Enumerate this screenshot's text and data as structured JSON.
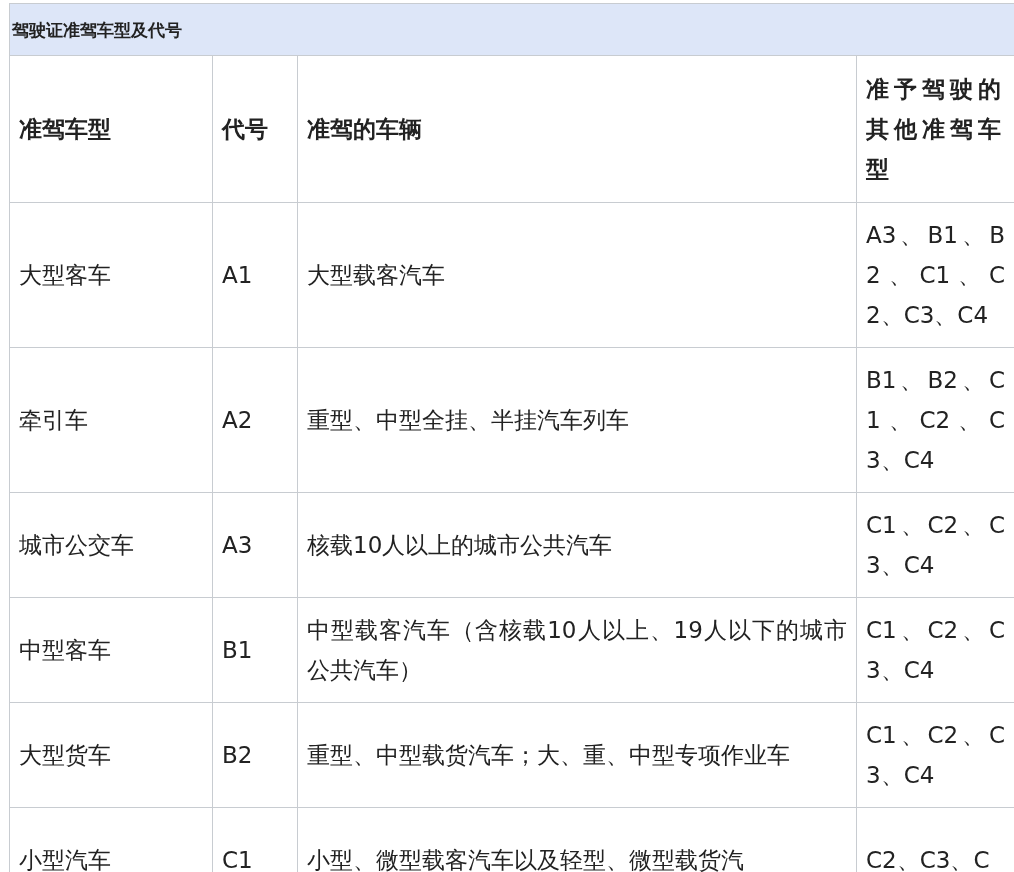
{
  "table": {
    "caption": "驾驶证准驾车型及代号",
    "columns": [
      "准驾车型",
      "代号",
      "准驾的车辆",
      "准予驾驶的其他准驾车型"
    ],
    "rows": [
      [
        "大型客车",
        "A1",
        "大型载客汽车",
        "A3、B1、B2、C1、C2、C3、C4"
      ],
      [
        "牵引车",
        "A2",
        "重型、中型全挂、半挂汽车列车",
        "B1、B2、C1、C2、C3、C4"
      ],
      [
        "城市公交车",
        "A3",
        "核载10人以上的城市公共汽车",
        "C1、C2、C3、C4"
      ],
      [
        "中型客车",
        "B1",
        "中型载客汽车（含核载10人以上、19人以下的城市公共汽车）",
        "C1、C2、C3、C4"
      ],
      [
        "大型货车",
        "B2",
        "重型、中型载货汽车；大、重、中型专项作业车",
        "C1、C2、C3、C4"
      ],
      [
        "小型汽车",
        "C1",
        "小型、微型载客汽车以及轻型、微型载货汽",
        "C2、C3、C"
      ]
    ]
  }
}
